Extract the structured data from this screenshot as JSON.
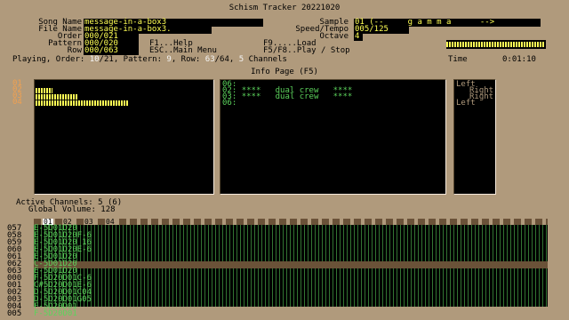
{
  "app": {
    "title": "Schism Tracker 20221020"
  },
  "song": {
    "song_name_label": "Song Name",
    "song_name": "message-in-a-box3",
    "file_name_label": "File Name",
    "file_name": "message-in-a-box3.",
    "order_label": "Order",
    "order": "000/021",
    "pattern_label": "Pattern",
    "pattern": "000/020",
    "row_label": "Row",
    "row": "000/063"
  },
  "help": {
    "f1": "F1...Help",
    "esc": "ESC..Main Menu",
    "f9": "F9.....Load",
    "f5f8": "F5/F8..Play / Stop"
  },
  "right": {
    "sample_label": "Sample",
    "sample": "01 (--     g a m m a      -->",
    "speed_label": "Speed/Tempo",
    "speed": "005/125",
    "octave_label": "Octave",
    "octave": "4"
  },
  "status": {
    "prefix": "Playing, Order: ",
    "order_cur": "10",
    "order_total": "/21",
    "pattern_text": ", Pattern: ",
    "pattern_val": "9",
    "row_text": ", Row: ",
    "row_cur": "63",
    "row_total": "/64",
    "chan_sep": ", ",
    "channels_val": "5",
    "channels_text": " Channels",
    "time_label": "Time",
    "time_val": "0:01:10"
  },
  "info_page": {
    "title": "Info Page (F5)",
    "channels": [
      "01",
      "02",
      "03",
      "04"
    ],
    "vu_levels": [
      0,
      0.1,
      0.25,
      0.55
    ],
    "samples": [
      {
        "num": "06:",
        "name": ""
      },
      {
        "num": "02:",
        "name": "****   dual crew   ****"
      },
      {
        "num": "03:",
        "name": "****   dual crew   ****"
      },
      {
        "num": "06:",
        "name": ""
      }
    ],
    "panning": [
      "Left",
      "Right",
      "Right",
      "Left"
    ]
  },
  "active": {
    "label": "Active Channels: 5 (6)",
    "volume": "Global Volume: 128"
  },
  "pattern_editor": {
    "channel_tabs": [
      "01",
      "02",
      "03",
      "04"
    ],
    "rows": [
      {
        "num": "057",
        "text": "E-5D01D20"
      },
      {
        "num": "058",
        "text": "E-5D01D20F-6"
      },
      {
        "num": "059",
        "text": "E-5D01D20 16"
      },
      {
        "num": "060",
        "text": "E-5D01D20E-6"
      },
      {
        "num": "061",
        "text": "E-5D01D20"
      },
      {
        "num": "062",
        "text": "C-5D01D20"
      },
      {
        "num": "063",
        "text": "E-5D01D20"
      },
      {
        "num": "000",
        "text": "F-5D20D01C-6"
      },
      {
        "num": "001",
        "text": "C#5D20D01E-6"
      },
      {
        "num": "002",
        "text": "D-5D20D01C04"
      },
      {
        "num": "003",
        "text": "D-5D20D01G05"
      },
      {
        "num": "004",
        "text": "F-5D20D01"
      },
      {
        "num": "005",
        "text": "F-5D20D01"
      }
    ]
  }
}
